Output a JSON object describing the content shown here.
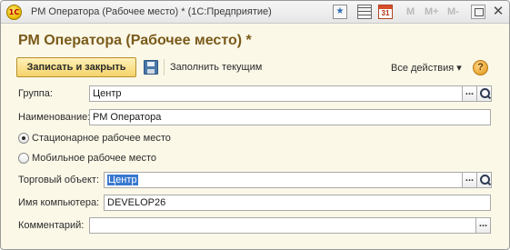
{
  "window": {
    "title": "РМ Оператора (Рабочее место) *  (1С:Предприятие)",
    "logo_text": "1С",
    "calendar_day": "31",
    "memory_buttons": [
      "M",
      "M+",
      "M-"
    ],
    "close_glyph": "✕"
  },
  "form": {
    "title": "РМ Оператора (Рабочее место) *"
  },
  "toolbar": {
    "save_close_label": "Записать и закрыть",
    "fill_current_label": "Заполнить текущим",
    "all_actions_label": "Все действия ▾",
    "help_label": "?"
  },
  "fields": {
    "group_label": "Группа:",
    "group_value": "Центр",
    "name_label": "Наименование:",
    "name_value": "РМ Оператора",
    "radio_stationary_label": "Стационарное рабочее место",
    "radio_mobile_label": "Мобильное рабочее место",
    "trade_object_label": "Торговый объект:",
    "trade_object_value": "Центр",
    "computer_name_label": "Имя компьютера:",
    "computer_name_value": "DEVELOP26",
    "comment_label": "Комментарий:",
    "comment_value": "",
    "select_button": "..."
  },
  "state": {
    "selected_workplace_type": "Стационарное рабочее место"
  },
  "colors": {
    "form_background": "#fbf8e8",
    "title_text": "#7a5a1a",
    "save_button": "#f5d36a",
    "selection": "#3878d0"
  },
  "icons": {
    "titlebar": [
      "1c-logo-icon",
      "favorites-icon",
      "calculator-icon",
      "calendar-icon",
      "restore-icon",
      "close-icon"
    ],
    "toolbar": [
      "save-disk-icon",
      "help-icon"
    ],
    "fields": [
      "select-ellipsis-icon",
      "search-magnifier-icon"
    ]
  }
}
